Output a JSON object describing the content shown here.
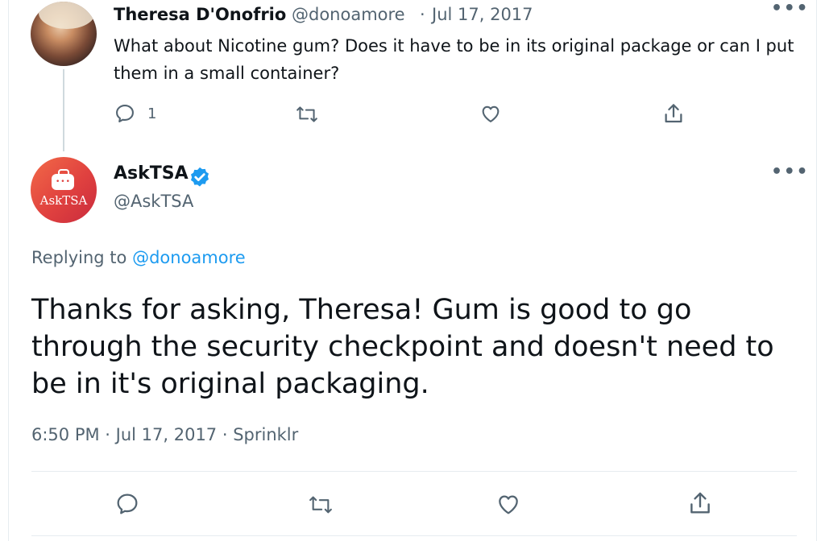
{
  "reply_to_tweet": {
    "author_name": "Theresa D'Onofrio",
    "handle": "@donoamore",
    "separator": "·",
    "date": "Jul 17, 2017",
    "text": "What about Nicotine gum? Does it have to be in its original package or can I put them in a small container?",
    "reply_count": "1",
    "icons": [
      "reply-icon",
      "retweet-icon",
      "like-icon",
      "share-icon"
    ]
  },
  "main_tweet": {
    "author_name": "AskTSA",
    "handle": "@AskTSA",
    "avatar_text": "AskTSA",
    "verified": true,
    "replying_prefix": "Replying to ",
    "replying_handle": "@donoamore",
    "text": "Thanks for asking, Theresa! Gum is good to go through the security checkpoint and doesn't need to be in it's original packaging.",
    "timestamp": "6:50 PM · Jul 17, 2017 · Sprinklr",
    "icons": [
      "reply-icon",
      "retweet-icon",
      "like-icon",
      "share-icon"
    ]
  },
  "colors": {
    "text": "#0f1419",
    "secondary": "#536471",
    "link": "#1d9bf0",
    "verified": "#1d9bf0",
    "divider": "#e6ecf0",
    "tsa_avatar": "#e0413f"
  }
}
